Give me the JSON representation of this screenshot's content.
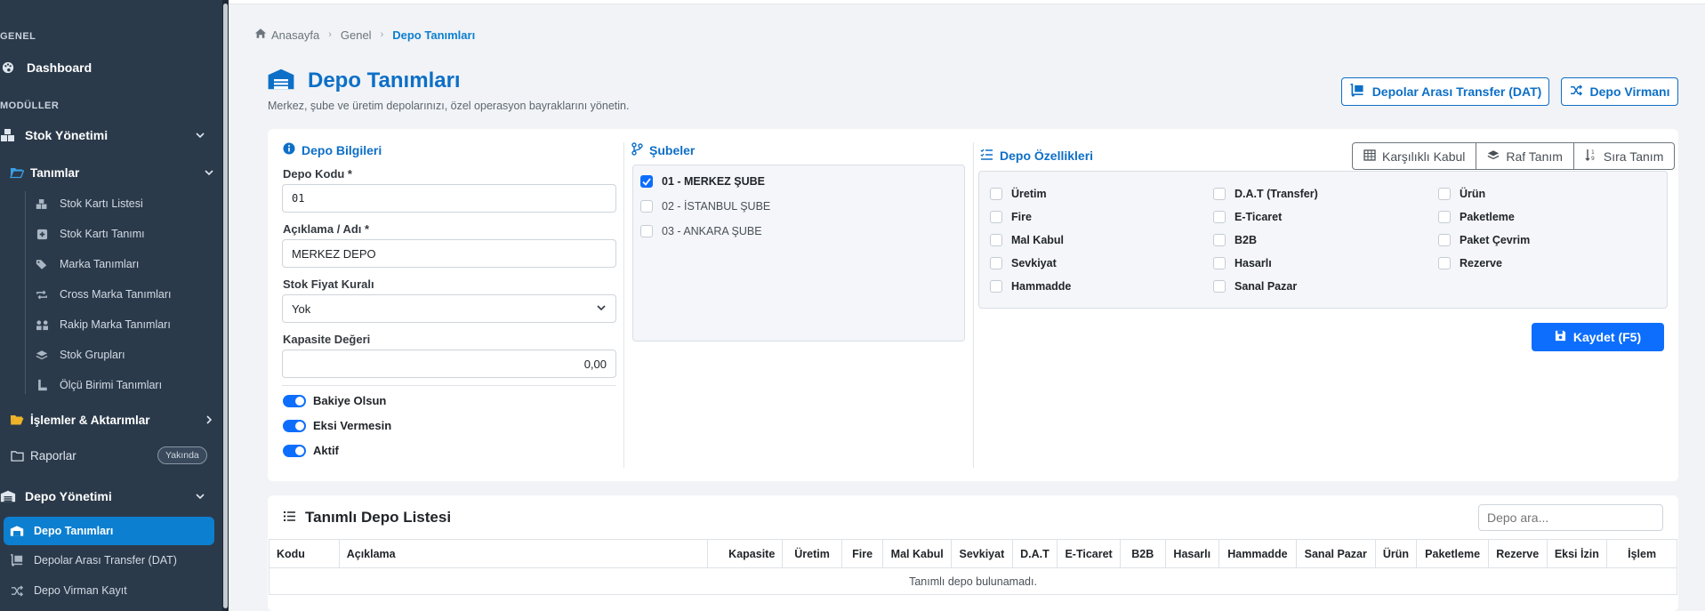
{
  "sidebar": {
    "section_general": "GENEL",
    "dashboard": "Dashboard",
    "section_modules": "MODÜLLER",
    "stock_management": "Stok Yönetimi",
    "definitions": "Tanımlar",
    "definition_items": [
      "Stok Kartı Listesi",
      "Stok Kartı Tanımı",
      "Marka Tanımları",
      "Cross Marka Tanımları",
      "Rakip Marka Tanımları",
      "Stok Grupları",
      "Ölçü Birimi Tanımları"
    ],
    "operations": "İşlemler & Aktarımlar",
    "reports": "Raporlar",
    "reports_badge": "Yakında",
    "warehouse_management": "Depo Yönetimi",
    "warehouse_items": [
      "Depo Tanımları",
      "Depolar Arası Transfer (DAT)",
      "Depo Virman Kayıt"
    ]
  },
  "breadcrumb": {
    "home": "Anasayfa",
    "general": "Genel",
    "current": "Depo Tanımları"
  },
  "page": {
    "title": "Depo Tanımları",
    "subtitle": "Merkez, şube ve üretim depolarınızı, özel operasyon bayraklarını yönetin.",
    "btn_transfer": "Depolar Arası Transfer (DAT)",
    "btn_virman": "Depo Virmanı"
  },
  "form": {
    "section_title": "Depo Bilgileri",
    "code_label": "Depo Kodu *",
    "code_value": "01",
    "desc_label": "Açıklama / Adı *",
    "desc_value": "MERKEZ DEPO",
    "price_rule_label": "Stok Fiyat Kuralı",
    "price_rule_value": "Yok",
    "capacity_label": "Kapasite Değeri",
    "capacity_value": "0,00",
    "toggles": [
      "Bakiye Olsun",
      "Eksi Vermesin",
      "Aktif"
    ]
  },
  "branches": {
    "title": "Şubeler",
    "items": [
      "01 - MERKEZ ŞUBE",
      "02 - İSTANBUL ŞUBE",
      "03 - ANKARA ŞUBE"
    ]
  },
  "features": {
    "title": "Depo Özellikleri",
    "buttons": [
      "Karşılıklı Kabul",
      "Raf Tanım",
      "Sıra Tanım"
    ],
    "col1": [
      "Üretim",
      "Fire",
      "Mal Kabul",
      "Sevkiyat",
      "Hammadde"
    ],
    "col2": [
      "D.A.T (Transfer)",
      "E-Ticaret",
      "B2B",
      "Hasarlı",
      "Sanal Pazar"
    ],
    "col3": [
      "Ürün",
      "Paketleme",
      "Paket Çevrim",
      "Rezerve"
    ],
    "save": "Kaydet (F5)"
  },
  "list": {
    "title": "Tanımlı Depo Listesi",
    "search_placeholder": "Depo ara...",
    "columns": [
      "Kodu",
      "Açıklama",
      "Kapasite",
      "Üretim",
      "Fire",
      "Mal Kabul",
      "Sevkiyat",
      "D.A.T",
      "E-Ticaret",
      "B2B",
      "Hasarlı",
      "Hammadde",
      "Sanal Pazar",
      "Ürün",
      "Paketleme",
      "Rezerve",
      "Eksi İzin",
      "İşlem"
    ],
    "empty": "Tanımlı depo bulunamadı."
  },
  "colors": {
    "sidebar": "#2b3a4a",
    "accent": "#0d6fc7",
    "primary": "#0d6efd",
    "active_item": "#0d7fd0"
  }
}
